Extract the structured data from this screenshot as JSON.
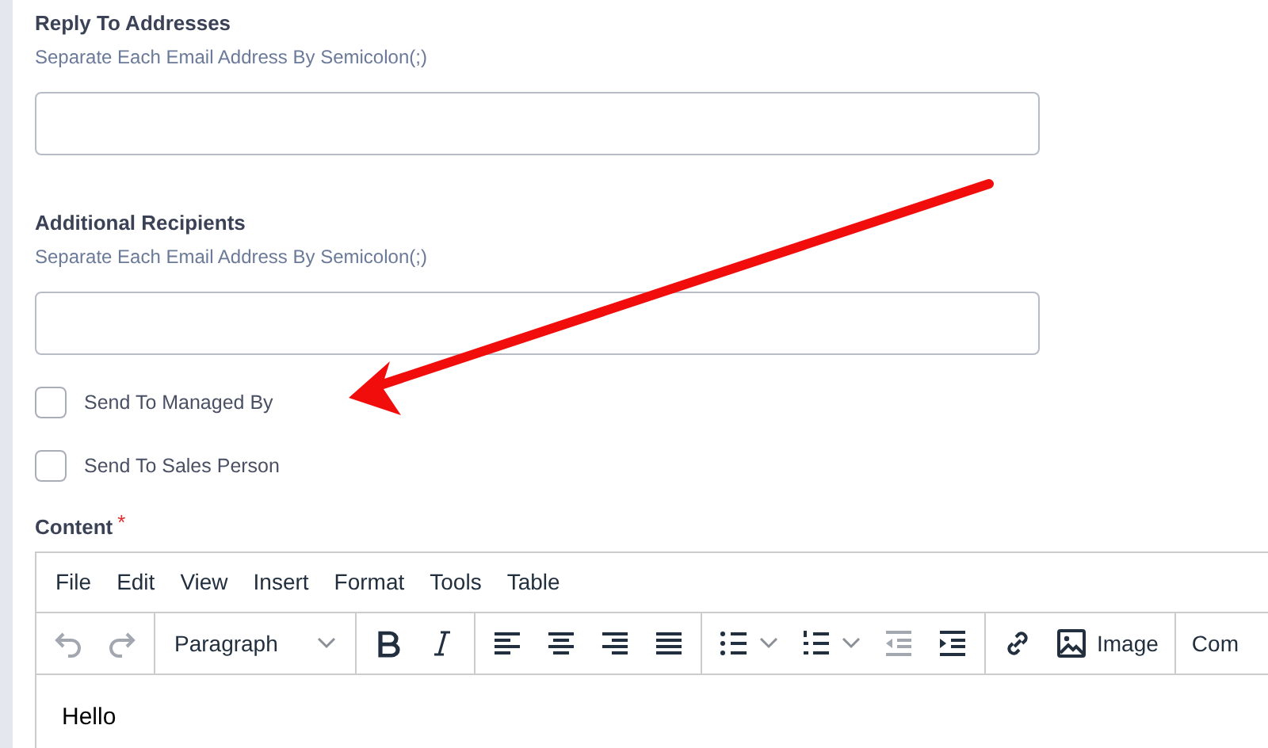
{
  "fields": [
    {
      "label": "Reply To Addresses",
      "hint": "Separate Each Email Address By Semicolon(;)"
    },
    {
      "label": "Additional Recipients",
      "hint": "Separate Each Email Address By Semicolon(;)"
    }
  ],
  "checkboxes": [
    {
      "label": "Send To Managed By",
      "checked": false
    },
    {
      "label": "Send To Sales Person",
      "checked": false
    }
  ],
  "content": {
    "label": "Content",
    "required_mark": "*",
    "menu": [
      "File",
      "Edit",
      "View",
      "Insert",
      "Format",
      "Tools",
      "Table"
    ],
    "toolbar": [
      [
        {
          "kind": "undo",
          "disabled": true
        },
        {
          "kind": "redo",
          "disabled": true
        }
      ],
      [
        {
          "kind": "select",
          "text": "Paragraph",
          "disabled": false
        }
      ],
      [
        {
          "kind": "bold",
          "disabled": false
        },
        {
          "kind": "italic",
          "disabled": false
        }
      ],
      [
        {
          "kind": "align-left",
          "disabled": false
        },
        {
          "kind": "align-center",
          "disabled": false
        },
        {
          "kind": "align-right",
          "disabled": false
        },
        {
          "kind": "justify",
          "disabled": false
        }
      ],
      [
        {
          "kind": "bullet-list",
          "disabled": false
        },
        {
          "kind": "numbered-list",
          "disabled": false
        },
        {
          "kind": "outdent",
          "disabled": true
        },
        {
          "kind": "indent",
          "disabled": false
        }
      ],
      [
        {
          "kind": "link",
          "disabled": false
        },
        {
          "kind": "image",
          "text": "Image",
          "disabled": false
        }
      ],
      [
        {
          "kind": "text",
          "text": "Com",
          "disabled": false
        }
      ]
    ],
    "body": "Hello"
  },
  "annotation": {
    "kind": "arrow"
  }
}
